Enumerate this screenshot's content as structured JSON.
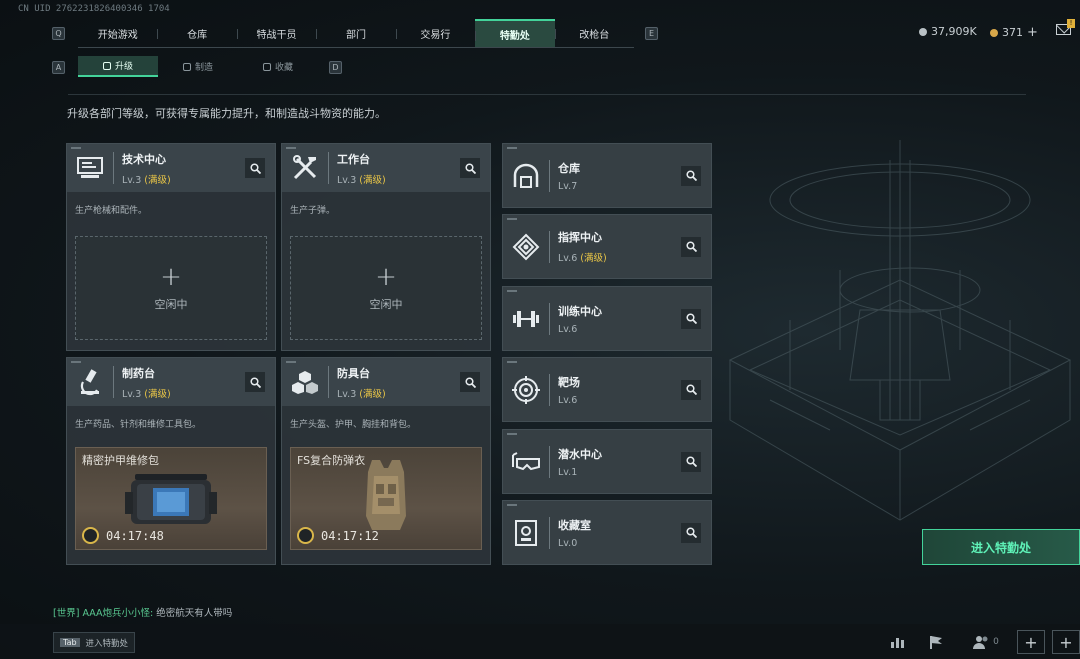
{
  "uid": "CN UID 2762231826400346 1704",
  "nav": {
    "left_key": "Q",
    "right_key": "E",
    "tabs": [
      {
        "label": "开始游戏"
      },
      {
        "label": "仓库"
      },
      {
        "label": "特战干员"
      },
      {
        "label": "部门"
      },
      {
        "label": "交易行"
      },
      {
        "label": "特勤处",
        "active": true
      },
      {
        "label": "改枪台"
      }
    ]
  },
  "currency": {
    "silver": "37,909K",
    "gold": "371",
    "plus": "+"
  },
  "mail_badge": "!",
  "subnav": {
    "left_key": "A",
    "right_key": "D",
    "tabs": [
      {
        "label": "升级",
        "icon": "upgrade-icon",
        "active": true
      },
      {
        "label": "制造",
        "icon": "craft-icon"
      },
      {
        "label": "收藏",
        "icon": "collection-icon"
      }
    ]
  },
  "description": "升级各部门等级，可获得专属能力提升，和制造战斗物资的能力。",
  "facilities": [
    {
      "title": "技术中心",
      "level": "Lv.3",
      "max": "(满级)",
      "desc": "生产枪械和配件。",
      "state": "idle",
      "idle_label": "空闲中",
      "icon": "computer-icon"
    },
    {
      "title": "工作台",
      "level": "Lv.3",
      "max": "(满级)",
      "desc": "生产子弹。",
      "state": "idle",
      "idle_label": "空闲中",
      "icon": "tools-icon"
    },
    {
      "title": "制药台",
      "level": "Lv.3",
      "max": "(满级)",
      "desc": "生产药品、针剂和维修工具包。",
      "state": "producing",
      "product": "精密护甲维修包",
      "time": "04:17:48",
      "icon": "microscope-icon"
    },
    {
      "title": "防具台",
      "level": "Lv.3",
      "max": "(满级)",
      "desc": "生产头盔、护甲、胸挂和背包。",
      "state": "producing",
      "product": "FS复合防弹衣",
      "time": "04:17:12",
      "icon": "cubes-icon"
    }
  ],
  "departments": [
    {
      "title": "仓库",
      "level": "Lv.7",
      "max": "",
      "icon": "warehouse-icon"
    },
    {
      "title": "指挥中心",
      "level": "Lv.6",
      "max": "(满级)",
      "icon": "command-icon"
    },
    {
      "title": "训练中心",
      "level": "Lv.6",
      "max": "",
      "icon": "dumbbell-icon"
    },
    {
      "title": "靶场",
      "level": "Lv.6",
      "max": "",
      "icon": "target-icon"
    },
    {
      "title": "潜水中心",
      "level": "Lv.1",
      "max": "",
      "icon": "diving-mask-icon"
    },
    {
      "title": "收藏室",
      "level": "Lv.0",
      "max": "",
      "icon": "collection-room-icon"
    }
  ],
  "enter_button": "进入特勤处",
  "chat": {
    "channel": "[世界]",
    "user": "AAA炮兵小小怪:",
    "message": "绝密航天有人带吗"
  },
  "bottom": {
    "tab_key": "Tab",
    "tab_label": "进入特勤处",
    "players_count": "0",
    "plus": "+"
  },
  "colors": {
    "accent": "#43d39a",
    "max_level": "#e8c547",
    "card_bg": "#2c3439"
  }
}
